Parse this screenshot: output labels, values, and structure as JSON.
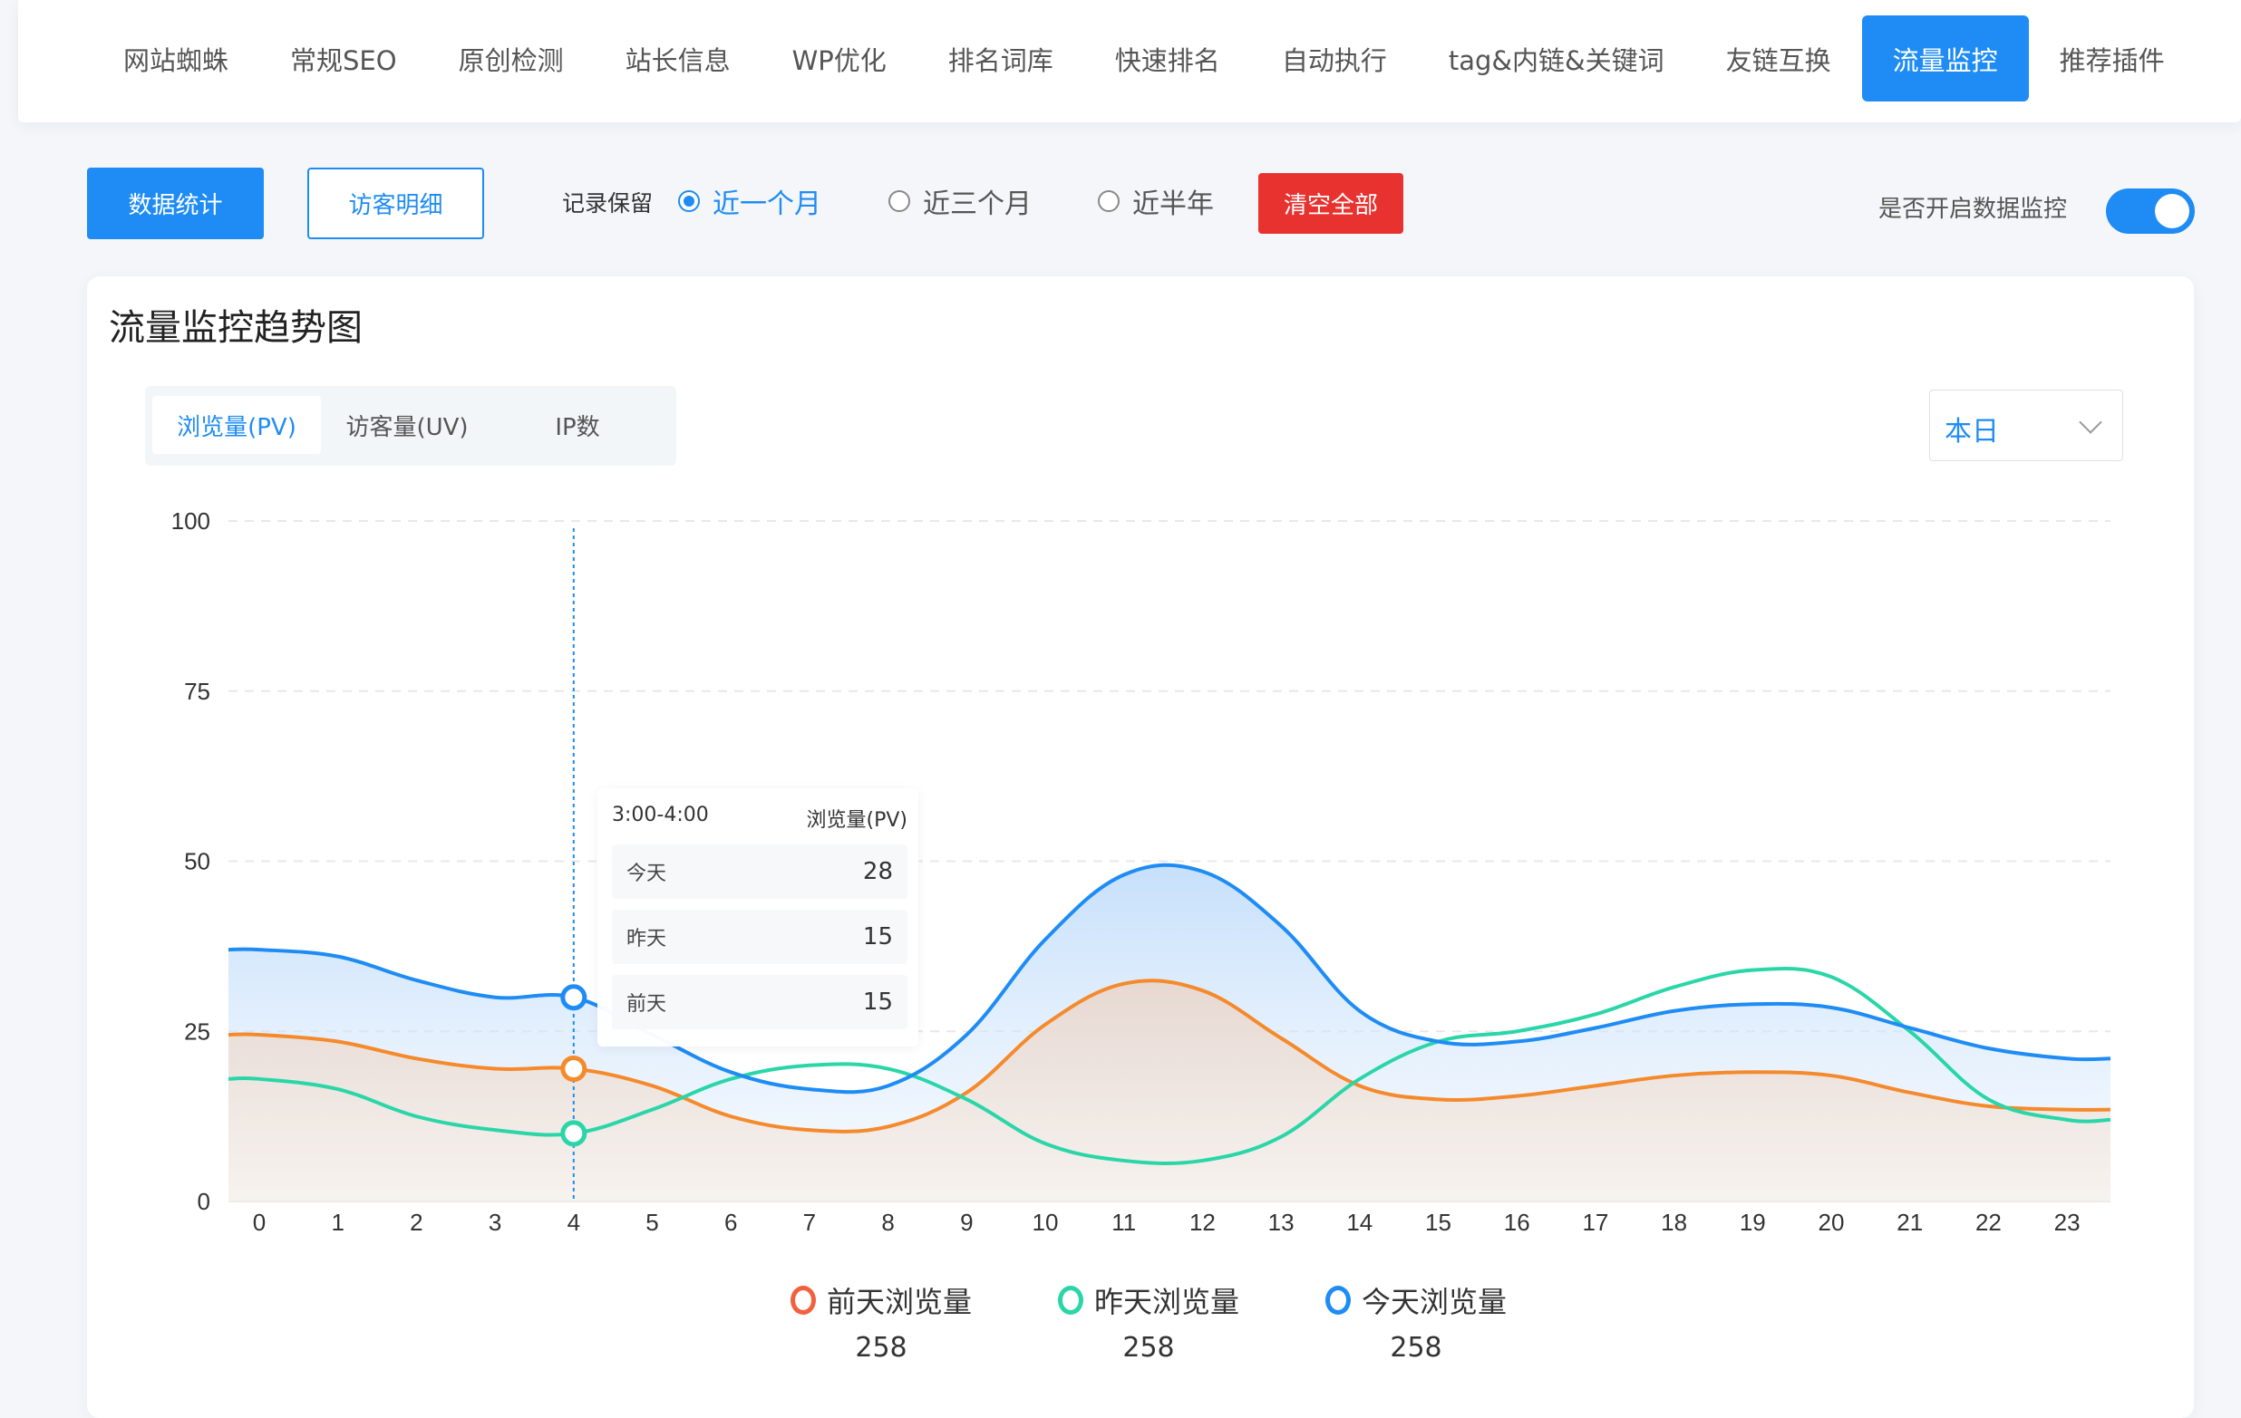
{
  "nav": {
    "tabs": [
      {
        "label": "网站蜘蛛",
        "active": false
      },
      {
        "label": "常规SEO",
        "active": false
      },
      {
        "label": "原创检测",
        "active": false
      },
      {
        "label": "站长信息",
        "active": false
      },
      {
        "label": "WP优化",
        "active": false
      },
      {
        "label": "排名词库",
        "active": false
      },
      {
        "label": "快速排名",
        "active": false
      },
      {
        "label": "自动执行",
        "active": false
      },
      {
        "label": "tag&内链&关键词",
        "active": false
      },
      {
        "label": "友链互换",
        "active": false
      },
      {
        "label": "流量监控",
        "active": true
      },
      {
        "label": "推荐插件",
        "active": false
      }
    ]
  },
  "toolbar": {
    "stats_button": "数据统计",
    "visitor_button": "访客明细",
    "retain_label": "记录保留",
    "retain_options": [
      {
        "label": "近一个月",
        "checked": true
      },
      {
        "label": "近三个月",
        "checked": false
      },
      {
        "label": "近半年",
        "checked": false
      }
    ],
    "clear_button": "清空全部",
    "monitor_label": "是否开启数据监控",
    "monitor_on": true
  },
  "card": {
    "title": "流量监控趋势图",
    "metric_tabs": [
      {
        "label": "浏览量(PV)",
        "active": true
      },
      {
        "label": "访客量(UV)",
        "active": false
      },
      {
        "label": "IP数",
        "active": false
      }
    ],
    "period_select": "本日"
  },
  "tooltip": {
    "time": "3:00-4:00",
    "metric": "浏览量(PV)",
    "rows": [
      {
        "label": "今天",
        "value": "28"
      },
      {
        "label": "昨天",
        "value": "15"
      },
      {
        "label": "前天",
        "value": "15"
      }
    ]
  },
  "chart_data": {
    "type": "area",
    "categories": [
      "0",
      "1",
      "2",
      "3",
      "4",
      "5",
      "6",
      "7",
      "8",
      "9",
      "10",
      "11",
      "12",
      "13",
      "14",
      "15",
      "16",
      "17",
      "18",
      "19",
      "20",
      "21",
      "22",
      "23"
    ],
    "ylim": [
      0,
      100
    ],
    "yticks": [
      0,
      25,
      50,
      75,
      100
    ],
    "grid": true,
    "highlight_index": 4,
    "series": [
      {
        "name": "前天浏览量",
        "color": "#f58a2c",
        "legend_color": "#f2603d",
        "total": "258",
        "values": [
          24.5,
          23.5,
          21,
          19.5,
          19.5,
          17,
          12.5,
          10.5,
          11,
          16,
          26,
          32,
          31,
          24,
          17,
          15,
          15.5,
          17,
          18.5,
          19,
          18.5,
          16,
          14,
          13.5
        ]
      },
      {
        "name": "昨天浏览量",
        "color": "#2ad6a8",
        "legend_color": "#2ad6a8",
        "total": "258",
        "values": [
          18,
          16.5,
          12.5,
          10.5,
          10,
          13.5,
          18,
          20,
          19.5,
          15,
          8.5,
          6,
          6,
          9.5,
          18,
          23.5,
          25,
          27.5,
          31.5,
          34,
          33,
          25,
          15,
          12
        ]
      },
      {
        "name": "今天浏览量",
        "color": "#1e8cf4",
        "legend_color": "#1e8cf4",
        "total": "258",
        "values": [
          37,
          36,
          32.5,
          30,
          30,
          24.5,
          19,
          16.5,
          17,
          24.5,
          38.5,
          48,
          48.5,
          40.5,
          28,
          23.5,
          23.5,
          25.5,
          28,
          29,
          28.5,
          25.5,
          22.5,
          21
        ]
      }
    ]
  }
}
